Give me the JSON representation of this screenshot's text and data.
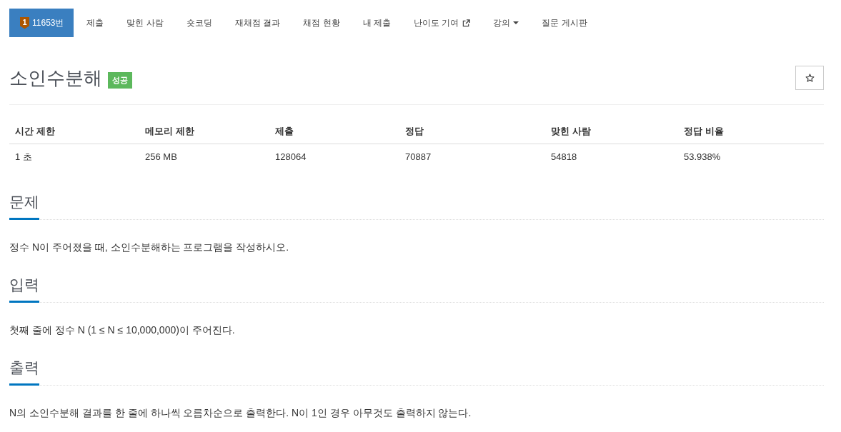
{
  "nav": {
    "tabs": [
      {
        "label": "11653번",
        "badge": "1",
        "kind": "problem",
        "selected": true
      },
      {
        "label": "제출",
        "kind": "link",
        "selected": false
      },
      {
        "label": "맞힌 사람",
        "kind": "link",
        "selected": false
      },
      {
        "label": "숏코딩",
        "kind": "link",
        "selected": false
      },
      {
        "label": "재채점 결과",
        "kind": "link",
        "selected": false
      },
      {
        "label": "채점 현황",
        "kind": "link",
        "selected": false
      },
      {
        "label": "내 제출",
        "kind": "link",
        "selected": false
      },
      {
        "label": "난이도 기여",
        "kind": "external",
        "selected": false
      },
      {
        "label": "강의",
        "kind": "dropdown",
        "selected": false
      },
      {
        "label": "질문 게시판",
        "kind": "link",
        "selected": false
      }
    ]
  },
  "problem": {
    "title": "소인수분해",
    "result_label": "성공"
  },
  "info_table": {
    "columns": [
      "시간 제한",
      "메모리 제한",
      "제출",
      "정답",
      "맞힌 사람",
      "정답 비율"
    ],
    "rows": [
      [
        "1 초",
        "256 MB",
        "128064",
        "70887",
        "54818",
        "53.938%"
      ]
    ]
  },
  "sections": [
    {
      "heading": "문제",
      "text": "정수 N이 주어졌을 때, 소인수분해하는 프로그램을 작성하시오."
    },
    {
      "heading": "입력",
      "text": "첫째 줄에 정수 N (1 ≤ N ≤ 10,000,000)이 주어진다."
    },
    {
      "heading": "출력",
      "text": "N의 소인수분해 결과를 한 줄에 하나씩 오름차순으로 출력한다. N이 1인 경우 아무것도 출력하지 않는다."
    }
  ]
}
